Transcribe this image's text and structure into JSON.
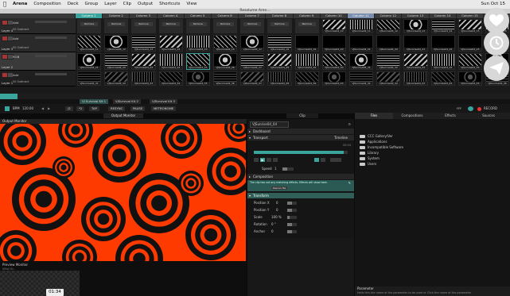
{
  "menubar": {
    "apple": "",
    "items": [
      "Arena",
      "Composition",
      "Deck",
      "Group",
      "Layer",
      "Clip",
      "Output",
      "Shortcuts",
      "View"
    ],
    "clock": "Sun Oct 15"
  },
  "window": {
    "title": "Resolume Aren..."
  },
  "grid": {
    "columns": [
      "Column 1",
      "Column 2",
      "Column 3",
      "Column 4",
      "Column 5",
      "Column 6",
      "Column 7",
      "Column 8",
      "Column 9",
      "Column 10",
      "Column 11",
      "Column 12",
      "Column 13",
      "Column 14",
      "Column 15",
      "Column 16"
    ],
    "layers": [
      {
        "name": "Layer 4",
        "blend": "Add",
        "mode": "50 Subtract"
      },
      {
        "name": "Layer 3",
        "blend": "Add",
        "mode": "50 Subtract"
      },
      {
        "name": "Layer 2",
        "blend": "RGB",
        "mode": ""
      },
      {
        "name": "Layer 1",
        "blend": "Add",
        "mode": "50 Subtract"
      }
    ],
    "remove_label": "Remove",
    "clip_prefix": "VJSunrise04_"
  },
  "deck_tabs": [
    "VJ Survival Kit 1",
    "VJSurvival Kit 2",
    "VJSurvival Kit 3"
  ],
  "transport": {
    "bpm": "BPM",
    "bpm_value": "120.00",
    "buttons": [
      "/2",
      "*2",
      "TAP",
      "RESYNC",
      "PAUSE",
      "METRONOME"
    ],
    "ffc": "FFF",
    "record": "RECORD"
  },
  "panels": {
    "output_monitor": "Output Monitor",
    "preview_monitor": "Preview Monitor",
    "clip": "Clip",
    "browser_tabs": [
      "Files",
      "Compositions",
      "Effects",
      "Sources"
    ],
    "parameter": "Parameter"
  },
  "clip_panel": {
    "clip_name": "VJSunrise04_04",
    "sections": {
      "dashboard": "Dashboard",
      "transport": "Transport",
      "timeline": "Timeline",
      "composition": "Composition",
      "transform": "Transform"
    },
    "time": "00:04",
    "speed_label": "Speed",
    "speed_value": "1",
    "note": "The clip has not any matching effects. Effects will show here.",
    "rescan": "Rescan file",
    "transform_rows": [
      {
        "label": "Position X",
        "value": "0"
      },
      {
        "label": "Position Y",
        "value": "0"
      },
      {
        "label": "Scale",
        "value": "100 %"
      },
      {
        "label": "Rotation",
        "value": "0 °"
      },
      {
        "label": "Anchor",
        "value": "0"
      }
    ]
  },
  "files": [
    {
      "name": "CCC Gallery/Ver"
    },
    {
      "name": "Applications"
    },
    {
      "name": "Incompatible Software"
    },
    {
      "name": "Library"
    },
    {
      "name": "System"
    },
    {
      "name": "Users"
    }
  ],
  "parameter_text": "Hello this the name of the parameter to be used or Click the name of the parameter",
  "preview": {
    "time": "01:34",
    "label_sub": "ViSol Gr.."
  },
  "overlay_icons": [
    "heart-icon",
    "clock-icon",
    "send-icon"
  ],
  "colors": {
    "accent": "#3aa59d",
    "output": "#ff3a00",
    "ring": "#111111"
  }
}
